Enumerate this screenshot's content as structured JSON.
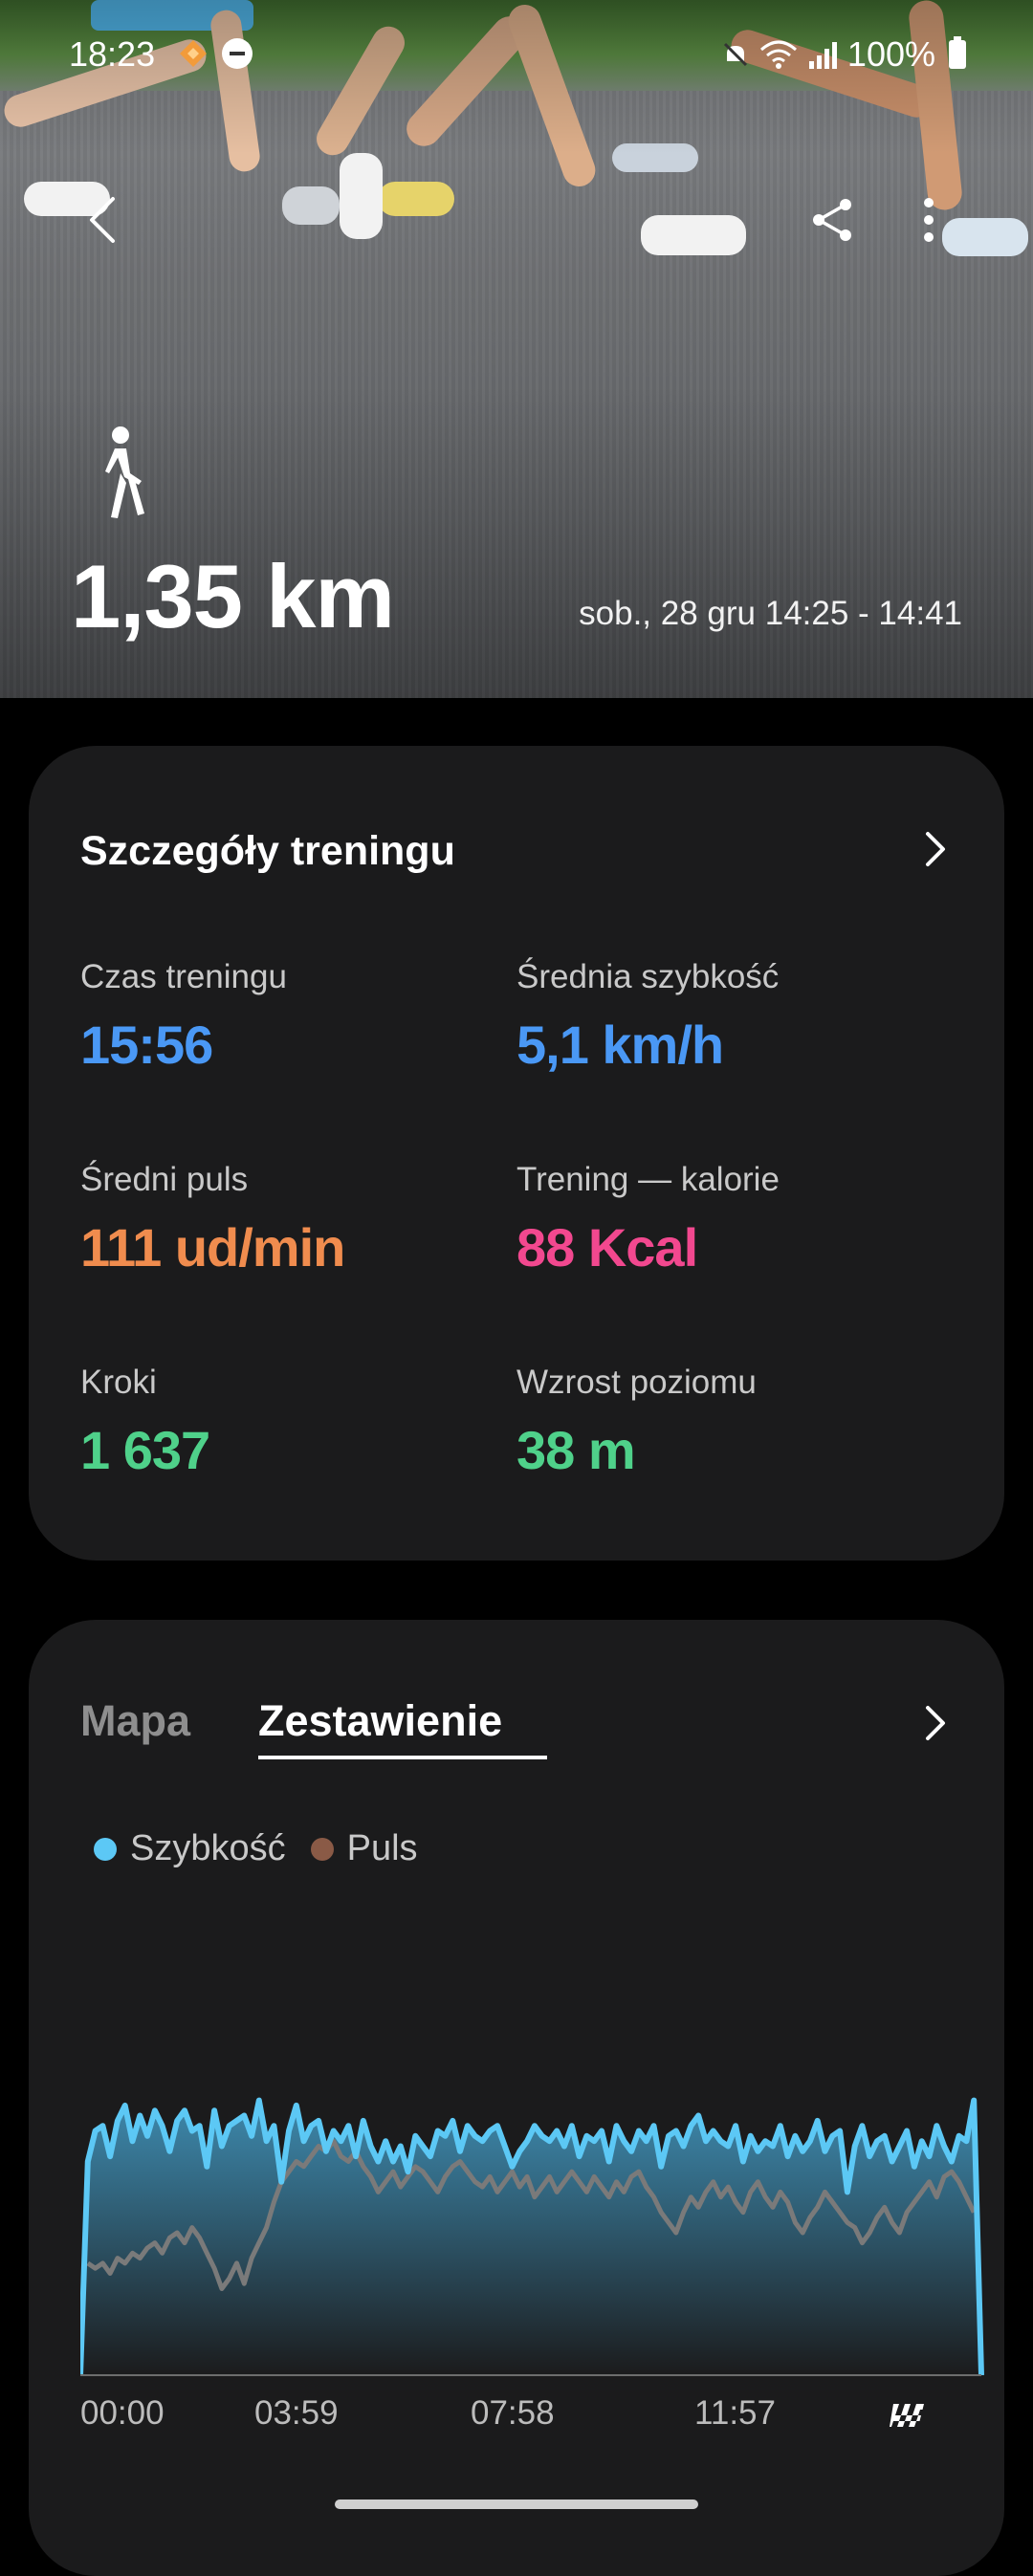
{
  "status_bar": {
    "time": "18:23",
    "battery": "100%"
  },
  "hero": {
    "distance": "1,35 km",
    "date_range": "sob., 28 gru 14:25 - 14:41",
    "icons": [
      "back-icon",
      "share-icon",
      "more-vert-icon",
      "walk-icon"
    ]
  },
  "details": {
    "title": "Szczegóły treningu",
    "metrics": [
      {
        "label": "Czas treningu",
        "value": "15:56",
        "color": "#4a98f5"
      },
      {
        "label": "Średnia szybkość",
        "value": "5,1 km/h",
        "color": "#4a98f5"
      },
      {
        "label": "Średni puls",
        "value": "111 ud/min",
        "color": "#f08c4e"
      },
      {
        "label": "Trening — kalorie",
        "value": "88 Kcal",
        "color": "#f2488f"
      },
      {
        "label": "Kroki",
        "value": "1 637",
        "color": "#4fd18a"
      },
      {
        "label": "Wzrost poziomu",
        "value": "38 m",
        "color": "#4fd18a"
      }
    ]
  },
  "summary": {
    "tabs": [
      {
        "label": "Mapa",
        "selected": false
      },
      {
        "label": "Zestawienie",
        "selected": true
      }
    ],
    "legend": [
      {
        "label": "Szybkość",
        "color": "#5cc8f5"
      },
      {
        "label": "Puls",
        "color": "#8a5a46"
      }
    ]
  },
  "chart_data": {
    "type": "area",
    "x_ticks": [
      "00:00",
      "03:59",
      "07:58",
      "11:57"
    ],
    "series": [
      {
        "name": "Szybkość",
        "color": "#5cc8f5",
        "values": [
          0,
          4.2,
          4.8,
          4.9,
          4.3,
          5.0,
          5.3,
          4.6,
          5.1,
          4.7,
          5.2,
          4.9,
          4.4,
          5.0,
          5.2,
          4.8,
          4.9,
          4.1,
          5.2,
          4.5,
          4.9,
          5.0,
          5.1,
          4.7,
          5.4,
          4.6,
          4.9,
          3.8,
          4.8,
          5.3,
          4.6,
          4.9,
          5.0,
          4.4,
          4.8,
          4.6,
          4.9,
          4.3,
          5.0,
          4.5,
          4.2,
          4.6,
          4.2,
          4.5,
          4.0,
          4.7,
          4.5,
          4.3,
          4.8,
          4.7,
          5.0,
          4.4,
          4.9,
          4.7,
          4.6,
          4.8,
          4.9,
          4.5,
          4.1,
          4.4,
          4.6,
          4.9,
          4.7,
          4.6,
          4.8,
          4.5,
          4.9,
          4.3,
          4.7,
          4.6,
          4.8,
          4.2,
          4.9,
          4.6,
          4.4,
          4.8,
          4.6,
          4.9,
          4.1,
          4.7,
          4.8,
          4.5,
          4.9,
          5.1,
          4.6,
          4.8,
          4.6,
          4.5,
          4.9,
          4.2,
          4.7,
          4.4,
          4.6,
          4.5,
          4.9,
          4.3,
          4.7,
          4.4,
          4.6,
          5.0,
          4.4,
          4.7,
          4.8,
          3.6,
          4.5,
          4.9,
          4.3,
          4.6,
          4.7,
          4.2,
          4.5,
          4.8,
          4.1,
          4.6,
          4.3,
          4.9,
          4.5,
          4.2,
          4.7,
          4.6,
          5.4,
          0
        ]
      },
      {
        "name": "Puls",
        "color": "#7a7a7a",
        "values": [
          0,
          2.2,
          2.1,
          2.2,
          2.0,
          2.3,
          2.2,
          2.4,
          2.3,
          2.5,
          2.6,
          2.4,
          2.7,
          2.8,
          2.6,
          2.9,
          2.7,
          2.4,
          2.1,
          1.7,
          1.9,
          2.2,
          1.8,
          2.3,
          2.6,
          2.9,
          3.4,
          3.8,
          4.0,
          4.2,
          4.1,
          4.3,
          4.5,
          4.4,
          4.6,
          4.3,
          4.2,
          4.4,
          4.1,
          3.9,
          3.6,
          3.8,
          4.0,
          3.7,
          3.9,
          4.1,
          4.0,
          3.8,
          3.6,
          3.9,
          4.1,
          4.2,
          4.0,
          3.8,
          3.7,
          3.9,
          3.6,
          3.8,
          4.0,
          3.7,
          3.9,
          3.5,
          3.7,
          3.9,
          3.6,
          3.8,
          4.0,
          3.8,
          3.6,
          3.9,
          3.7,
          3.5,
          3.8,
          3.6,
          3.9,
          4.0,
          3.7,
          3.5,
          3.2,
          3.0,
          2.8,
          3.2,
          3.5,
          3.3,
          3.6,
          3.8,
          3.5,
          3.7,
          3.4,
          3.2,
          3.6,
          3.8,
          3.5,
          3.3,
          3.6,
          3.4,
          3.0,
          2.8,
          3.1,
          3.3,
          3.6,
          3.4,
          3.2,
          3.0,
          2.9,
          2.6,
          2.8,
          3.1,
          3.3,
          3.0,
          2.8,
          3.2,
          3.4,
          3.6,
          3.8,
          3.5,
          3.9,
          4.0,
          3.8,
          3.5,
          3.2,
          0
        ]
      }
    ]
  }
}
